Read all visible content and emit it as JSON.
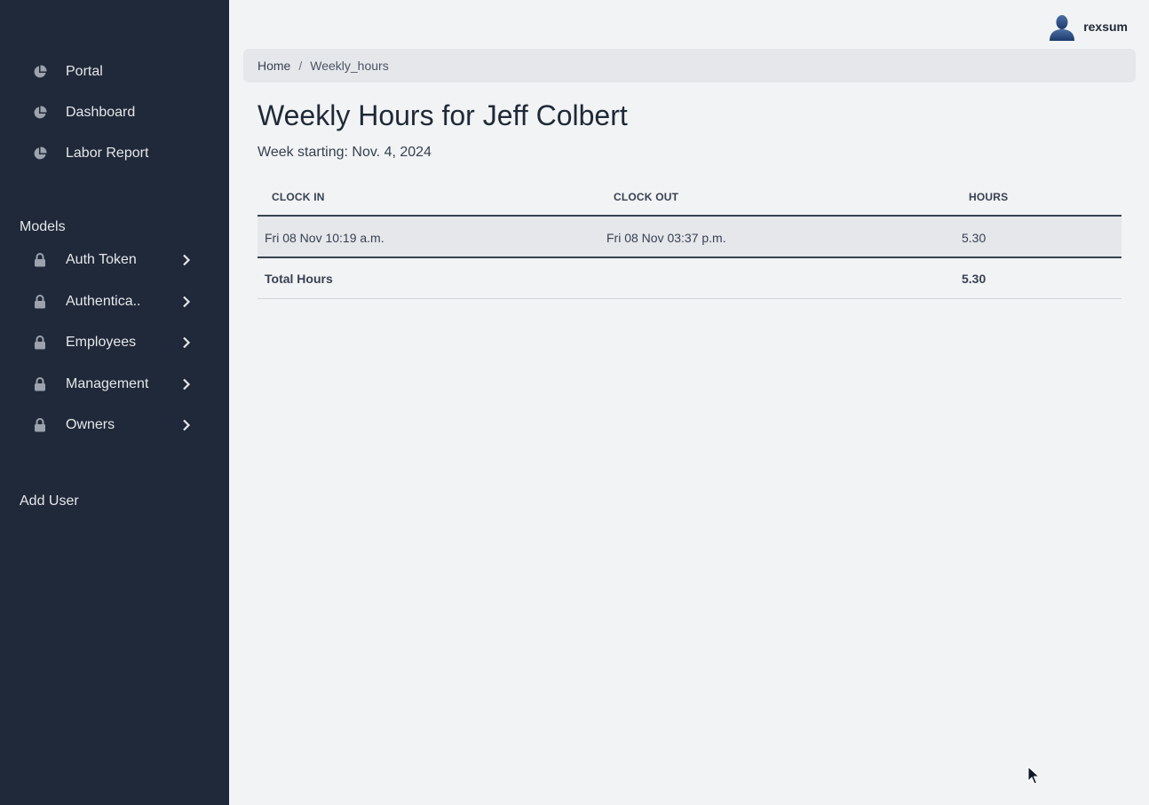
{
  "sidebar": {
    "items": [
      {
        "label": "Portal",
        "icon": "pie-chart-icon"
      },
      {
        "label": "Dashboard",
        "icon": "pie-chart-icon"
      },
      {
        "label": "Labor Report",
        "icon": "pie-chart-icon"
      }
    ],
    "models_title": "Models",
    "models": [
      {
        "label": "Auth Token",
        "icon": "lock-icon"
      },
      {
        "label": "Authentica..",
        "icon": "lock-icon"
      },
      {
        "label": "Employees",
        "icon": "lock-icon"
      },
      {
        "label": "Management",
        "icon": "lock-icon"
      },
      {
        "label": "Owners",
        "icon": "lock-icon"
      }
    ],
    "add_user_label": "Add User"
  },
  "header": {
    "username": "rexsum"
  },
  "breadcrumb": {
    "home": "Home",
    "separator": "/",
    "current": "Weekly_hours"
  },
  "main": {
    "title": "Weekly Hours for Jeff Colbert",
    "subtitle": "Week starting: Nov. 4, 2024",
    "table": {
      "columns": [
        "CLOCK IN",
        "CLOCK OUT",
        "HOURS"
      ],
      "rows": [
        {
          "clock_in": "Fri 08 Nov 10:19 a.m.",
          "clock_out": "Fri 08 Nov 03:37 p.m.",
          "hours": "5.30"
        }
      ],
      "total_label": "Total Hours",
      "total_value": "5.30"
    }
  },
  "colors": {
    "sidebar_bg": "#202939",
    "page_bg": "#f2f3f5",
    "breadcrumb_bg": "#e5e7eb"
  }
}
